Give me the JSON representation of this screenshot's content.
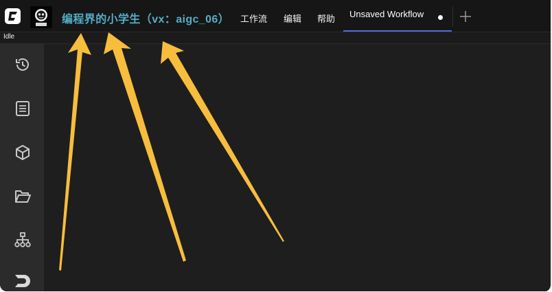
{
  "header": {
    "brand_title": "编程界的小学生（vx：aigc_06）",
    "menu": [
      {
        "label": "工作流"
      },
      {
        "label": "编辑"
      },
      {
        "label": "帮助"
      }
    ],
    "tab": {
      "label": "Unsaved Workflow"
    }
  },
  "status": {
    "text": "Idle"
  },
  "sidebar": {
    "items": [
      {
        "icon": "history-icon"
      },
      {
        "icon": "document-list-icon"
      },
      {
        "icon": "cube-icon"
      },
      {
        "icon": "folder-open-icon"
      },
      {
        "icon": "sitemap-icon"
      },
      {
        "icon": "sd-logo-icon"
      }
    ]
  },
  "colors": {
    "brand_title": "#54aec6",
    "annotation_arrow": "#f7bd3d",
    "active_tab_underline": "#4e6dd8"
  }
}
